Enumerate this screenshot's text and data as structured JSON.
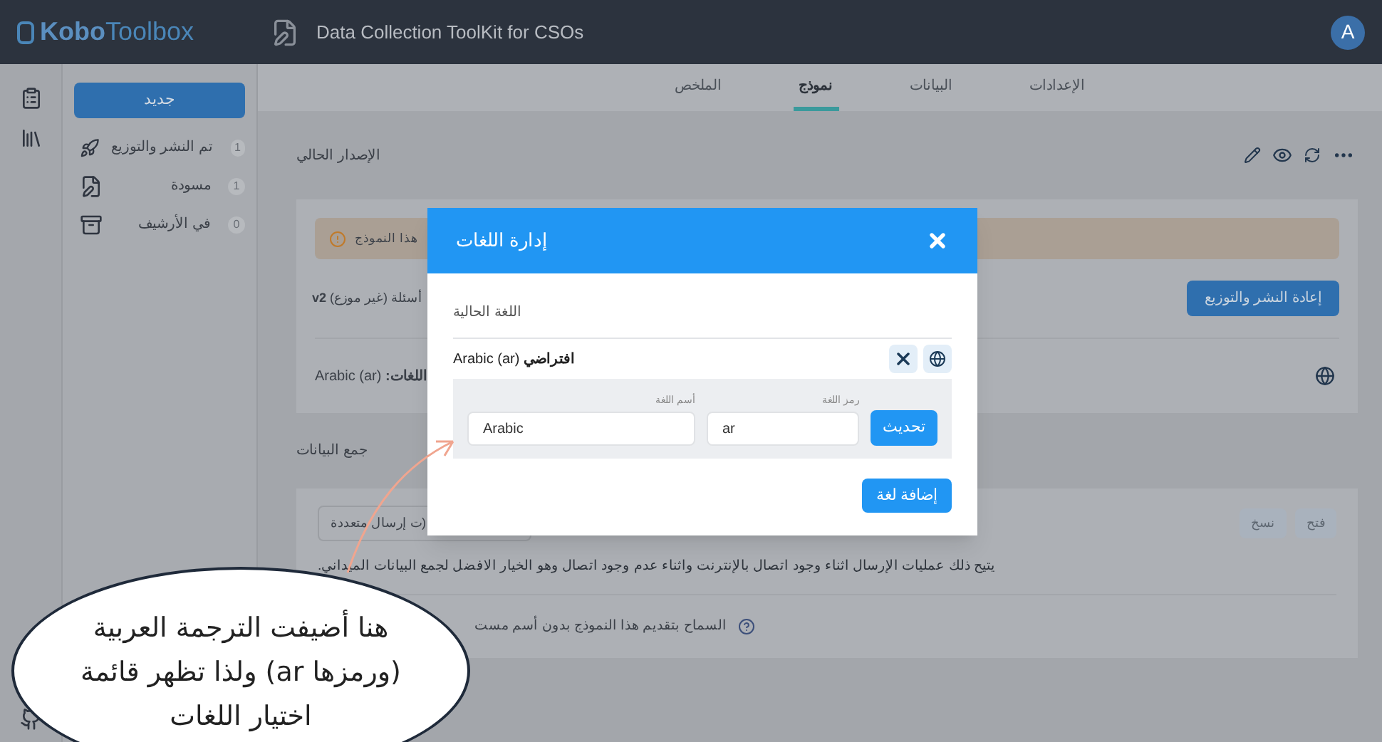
{
  "header": {
    "logo_bold": "Kobo",
    "logo_light": "Toolbox",
    "project_title": "Data Collection ToolKit for CSOs",
    "avatar": "A"
  },
  "sidebar": {
    "new_button": "جديد",
    "items": [
      {
        "kind": "deployed",
        "label": "تم النشر والتوزيع",
        "count": "1"
      },
      {
        "kind": "draft",
        "label": "مسودة",
        "count": "1"
      },
      {
        "kind": "archived",
        "label": "في الأرشيف",
        "count": "0"
      }
    ]
  },
  "tabs": [
    {
      "label": "الإعدادات",
      "selected": false
    },
    {
      "label": "البيانات",
      "selected": false
    },
    {
      "label": "نموذج",
      "selected": true
    },
    {
      "label": "الملخص",
      "selected": false
    }
  ],
  "current_version": {
    "heading": "الإصدار الحالي",
    "warning": "هذا النموذج",
    "questions": "أسئلة (غير موزع) ",
    "version": "v2",
    "redeploy_button": "إعادة النشر والتوزيع",
    "languages_label": "اللغات:",
    "languages_value": " Arabic (ar)"
  },
  "data_collection": {
    "heading": "جمع البيانات",
    "select_value": "ت إرسال متعددة)",
    "buttons": [
      {
        "label": "فتح"
      },
      {
        "label": "نسخ"
      }
    ],
    "description": "يتيح ذلك عمليات الإرسال اثناء وجود اتصال بالإنترنت واثناء عدم وجود اتصال وهو الخيار الافضل لجمع البيانات الميداني.",
    "anonymous_option": "السماح بتقديم هذا النموذج بدون أسم مست"
  },
  "modal": {
    "title": "إدارة اللغات",
    "current_label": "اللغة الحالية",
    "language": "Arabic (ar)",
    "default_label": "افتراضي",
    "name_label": "أسم اللغة",
    "name_value": "Arabic",
    "code_label": "رمز اللغة",
    "code_value": "ar",
    "update_button": "تحديث",
    "add_button": "إضافة لغة"
  },
  "annotation": {
    "lines": [
      "هنا أضيفت الترجمة العربية",
      "(ورمزها ar)  ولذا تظهر قائمة",
      "اختيار اللغات"
    ]
  }
}
